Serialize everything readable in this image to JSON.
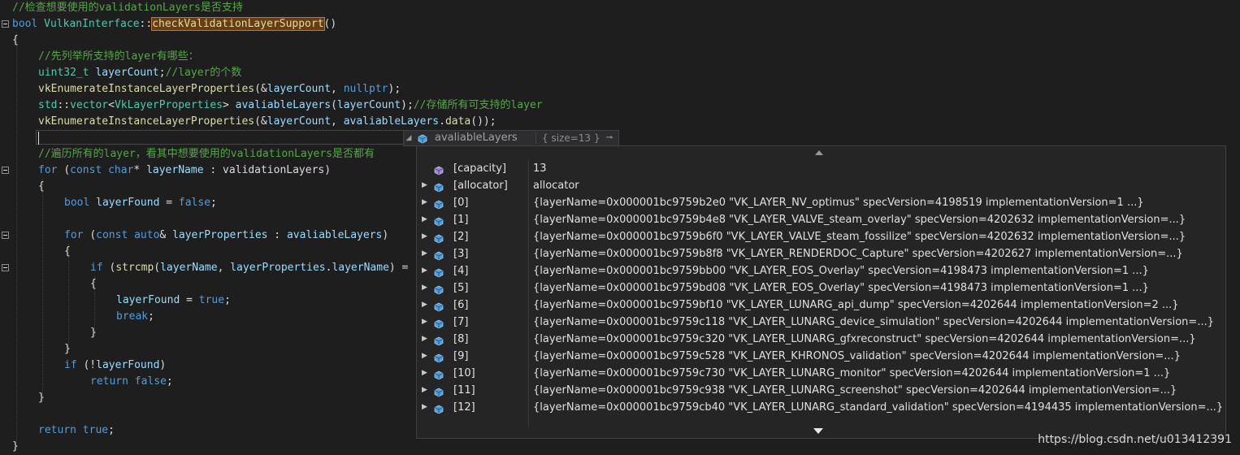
{
  "code_lines": [
    {
      "t": 10,
      "indent": 0,
      "tokens": [
        {
          "c": "comment",
          "s": "//检查想要使用的validationLayers是否支持"
        }
      ]
    },
    {
      "t": 30,
      "indent": 0,
      "fold": true,
      "tokens": [
        {
          "c": "kw",
          "s": "bool "
        },
        {
          "c": "type",
          "s": "VulkanInterface"
        },
        {
          "c": "pl",
          "s": "::"
        },
        {
          "c": "hl",
          "s": "checkValidationLayerSupport"
        },
        {
          "c": "pl",
          "s": "()"
        }
      ]
    },
    {
      "t": 50,
      "indent": 0,
      "tokens": [
        {
          "c": "pl",
          "s": "{"
        }
      ]
    },
    {
      "t": 70,
      "indent": 32,
      "tokens": [
        {
          "c": "comment",
          "s": "//先列举所支持的layer有哪些："
        }
      ]
    },
    {
      "t": 90,
      "indent": 32,
      "tokens": [
        {
          "c": "type",
          "s": "uint32_t "
        },
        {
          "c": "var",
          "s": "layerCount"
        },
        {
          "c": "pl",
          "s": ";"
        },
        {
          "c": "comment",
          "s": "//layer的个数"
        }
      ]
    },
    {
      "t": 110,
      "indent": 32,
      "tokens": [
        {
          "c": "fn",
          "s": "vkEnumerateInstanceLayerProperties"
        },
        {
          "c": "pl",
          "s": "(&"
        },
        {
          "c": "var",
          "s": "layerCount"
        },
        {
          "c": "pl",
          "s": ", "
        },
        {
          "c": "kw",
          "s": "nullptr"
        },
        {
          "c": "pl",
          "s": ");"
        }
      ]
    },
    {
      "t": 130,
      "indent": 32,
      "tokens": [
        {
          "c": "type",
          "s": "std"
        },
        {
          "c": "pl",
          "s": "::"
        },
        {
          "c": "type",
          "s": "vector"
        },
        {
          "c": "pl",
          "s": "<"
        },
        {
          "c": "type",
          "s": "VkLayerProperties"
        },
        {
          "c": "pl",
          "s": "> "
        },
        {
          "c": "var",
          "s": "avaliableLayers"
        },
        {
          "c": "pl",
          "s": "("
        },
        {
          "c": "var",
          "s": "layerCount"
        },
        {
          "c": "pl",
          "s": ");"
        },
        {
          "c": "comment",
          "s": "//存储所有可支持的layer"
        }
      ]
    },
    {
      "t": 150,
      "indent": 32,
      "tokens": [
        {
          "c": "fn",
          "s": "vkEnumerateInstanceLayerProperties"
        },
        {
          "c": "pl",
          "s": "(&"
        },
        {
          "c": "var",
          "s": "layerCount"
        },
        {
          "c": "pl",
          "s": ", "
        },
        {
          "c": "var",
          "s": "avaliableLayers"
        },
        {
          "c": "pl",
          "s": "."
        },
        {
          "c": "fn",
          "s": "data"
        },
        {
          "c": "pl",
          "s": "());"
        }
      ]
    },
    {
      "t": 190,
      "indent": 32,
      "tokens": [
        {
          "c": "comment",
          "s": "//遍历所有的layer，看其中想要使用的validationLayers是否都有"
        }
      ]
    },
    {
      "t": 210,
      "indent": 32,
      "fold": true,
      "tokens": [
        {
          "c": "kw",
          "s": "for "
        },
        {
          "c": "pl",
          "s": "("
        },
        {
          "c": "kw",
          "s": "const char"
        },
        {
          "c": "pl",
          "s": "* "
        },
        {
          "c": "var",
          "s": "layerName"
        },
        {
          "c": "pl",
          "s": " : validationLayers)"
        }
      ]
    },
    {
      "t": 230,
      "indent": 32,
      "tokens": [
        {
          "c": "pl",
          "s": "{"
        }
      ]
    },
    {
      "t": 250,
      "indent": 64,
      "tokens": [
        {
          "c": "kw",
          "s": "bool "
        },
        {
          "c": "var",
          "s": "layerFound"
        },
        {
          "c": "pl",
          "s": " = "
        },
        {
          "c": "kw",
          "s": "false"
        },
        {
          "c": "pl",
          "s": ";"
        }
      ]
    },
    {
      "t": 290,
      "indent": 64,
      "fold": true,
      "tokens": [
        {
          "c": "kw",
          "s": "for "
        },
        {
          "c": "pl",
          "s": "("
        },
        {
          "c": "kw",
          "s": "const auto"
        },
        {
          "c": "pl",
          "s": "& "
        },
        {
          "c": "var",
          "s": "layerProperties"
        },
        {
          "c": "pl",
          "s": " : "
        },
        {
          "c": "var",
          "s": "avaliableLayers"
        },
        {
          "c": "pl",
          "s": ")"
        }
      ]
    },
    {
      "t": 310,
      "indent": 64,
      "tokens": [
        {
          "c": "pl",
          "s": "{"
        }
      ]
    },
    {
      "t": 330,
      "indent": 96,
      "fold": true,
      "tokens": [
        {
          "c": "kw",
          "s": "if "
        },
        {
          "c": "pl",
          "s": "("
        },
        {
          "c": "fn",
          "s": "strcmp"
        },
        {
          "c": "pl",
          "s": "("
        },
        {
          "c": "var",
          "s": "layerName"
        },
        {
          "c": "pl",
          "s": ", "
        },
        {
          "c": "var",
          "s": "layerProperties"
        },
        {
          "c": "pl",
          "s": "."
        },
        {
          "c": "var",
          "s": "layerName"
        },
        {
          "c": "pl",
          "s": ") ="
        }
      ]
    },
    {
      "t": 350,
      "indent": 96,
      "tokens": [
        {
          "c": "pl",
          "s": "{"
        }
      ]
    },
    {
      "t": 370,
      "indent": 128,
      "tokens": [
        {
          "c": "var",
          "s": "layerFound"
        },
        {
          "c": "pl",
          "s": " = "
        },
        {
          "c": "kw",
          "s": "true"
        },
        {
          "c": "pl",
          "s": ";"
        }
      ]
    },
    {
      "t": 390,
      "indent": 128,
      "tokens": [
        {
          "c": "kw",
          "s": "break"
        },
        {
          "c": "pl",
          "s": ";"
        }
      ]
    },
    {
      "t": 410,
      "indent": 96,
      "tokens": [
        {
          "c": "pl",
          "s": "}"
        }
      ]
    },
    {
      "t": 430,
      "indent": 64,
      "tokens": [
        {
          "c": "pl",
          "s": "}"
        }
      ]
    },
    {
      "t": 450,
      "indent": 64,
      "tokens": [
        {
          "c": "kw",
          "s": "if "
        },
        {
          "c": "pl",
          "s": "(!"
        },
        {
          "c": "var",
          "s": "layerFound"
        },
        {
          "c": "pl",
          "s": ")"
        }
      ]
    },
    {
      "t": 470,
      "indent": 96,
      "tokens": [
        {
          "c": "kw",
          "s": "return false"
        },
        {
          "c": "pl",
          "s": ";"
        }
      ]
    },
    {
      "t": 490,
      "indent": 32,
      "tokens": [
        {
          "c": "pl",
          "s": "}"
        }
      ]
    },
    {
      "t": 530,
      "indent": 32,
      "tokens": [
        {
          "c": "kw",
          "s": "return true"
        },
        {
          "c": "pl",
          "s": ";"
        }
      ]
    },
    {
      "t": 550,
      "indent": 0,
      "tokens": [
        {
          "c": "pl",
          "s": "}"
        }
      ]
    }
  ],
  "datatip": {
    "name": "avaliableLayers",
    "value": "{ size=13 }",
    "colors": {
      "cube": "#4aa0e0",
      "field_cube": "#b180d7"
    },
    "rows": [
      {
        "name": "[capacity]",
        "value": "13",
        "expandable": false,
        "icon": "field-cube"
      },
      {
        "name": "[allocator]",
        "value": "allocator",
        "expandable": true,
        "icon": "cube"
      },
      {
        "name": "[0]",
        "value": "{layerName=0x000001bc9759b2e0 \"VK_LAYER_NV_optimus\" specVersion=4198519 implementationVersion=1 ...}",
        "expandable": true,
        "icon": "cube"
      },
      {
        "name": "[1]",
        "value": "{layerName=0x000001bc9759b4e8 \"VK_LAYER_VALVE_steam_overlay\" specVersion=4202632 implementationVersion=...}",
        "expandable": true,
        "icon": "cube"
      },
      {
        "name": "[2]",
        "value": "{layerName=0x000001bc9759b6f0 \"VK_LAYER_VALVE_steam_fossilize\" specVersion=4202632 implementationVersion=...}",
        "expandable": true,
        "icon": "cube"
      },
      {
        "name": "[3]",
        "value": "{layerName=0x000001bc9759b8f8 \"VK_LAYER_RENDERDOC_Capture\" specVersion=4202627 implementationVersion=...}",
        "expandable": true,
        "icon": "cube"
      },
      {
        "name": "[4]",
        "value": "{layerName=0x000001bc9759bb00 \"VK_LAYER_EOS_Overlay\" specVersion=4198473 implementationVersion=1 ...}",
        "expandable": true,
        "icon": "cube"
      },
      {
        "name": "[5]",
        "value": "{layerName=0x000001bc9759bd08 \"VK_LAYER_EOS_Overlay\" specVersion=4198473 implementationVersion=1 ...}",
        "expandable": true,
        "icon": "cube"
      },
      {
        "name": "[6]",
        "value": "{layerName=0x000001bc9759bf10 \"VK_LAYER_LUNARG_api_dump\" specVersion=4202644 implementationVersion=2 ...}",
        "expandable": true,
        "icon": "cube"
      },
      {
        "name": "[7]",
        "value": "{layerName=0x000001bc9759c118 \"VK_LAYER_LUNARG_device_simulation\" specVersion=4202644 implementationVersion=...}",
        "expandable": true,
        "icon": "cube"
      },
      {
        "name": "[8]",
        "value": "{layerName=0x000001bc9759c320 \"VK_LAYER_LUNARG_gfxreconstruct\" specVersion=4202644 implementationVersion=...}",
        "expandable": true,
        "icon": "cube"
      },
      {
        "name": "[9]",
        "value": "{layerName=0x000001bc9759c528 \"VK_LAYER_KHRONOS_validation\" specVersion=4202644 implementationVersion=...}",
        "expandable": true,
        "icon": "cube"
      },
      {
        "name": "[10]",
        "value": "{layerName=0x000001bc9759c730 \"VK_LAYER_LUNARG_monitor\" specVersion=4202644 implementationVersion=1 ...}",
        "expandable": true,
        "icon": "cube"
      },
      {
        "name": "[11]",
        "value": "{layerName=0x000001bc9759c938 \"VK_LAYER_LUNARG_screenshot\" specVersion=4202644 implementationVersion=...}",
        "expandable": true,
        "icon": "cube"
      },
      {
        "name": "[12]",
        "value": "{layerName=0x000001bc9759cb40 \"VK_LAYER_LUNARG_standard_validation\" specVersion=4194435 implementationVersion=...}",
        "expandable": true,
        "icon": "cube"
      }
    ]
  },
  "watermark": "https://blog.csdn.net/u013412391"
}
